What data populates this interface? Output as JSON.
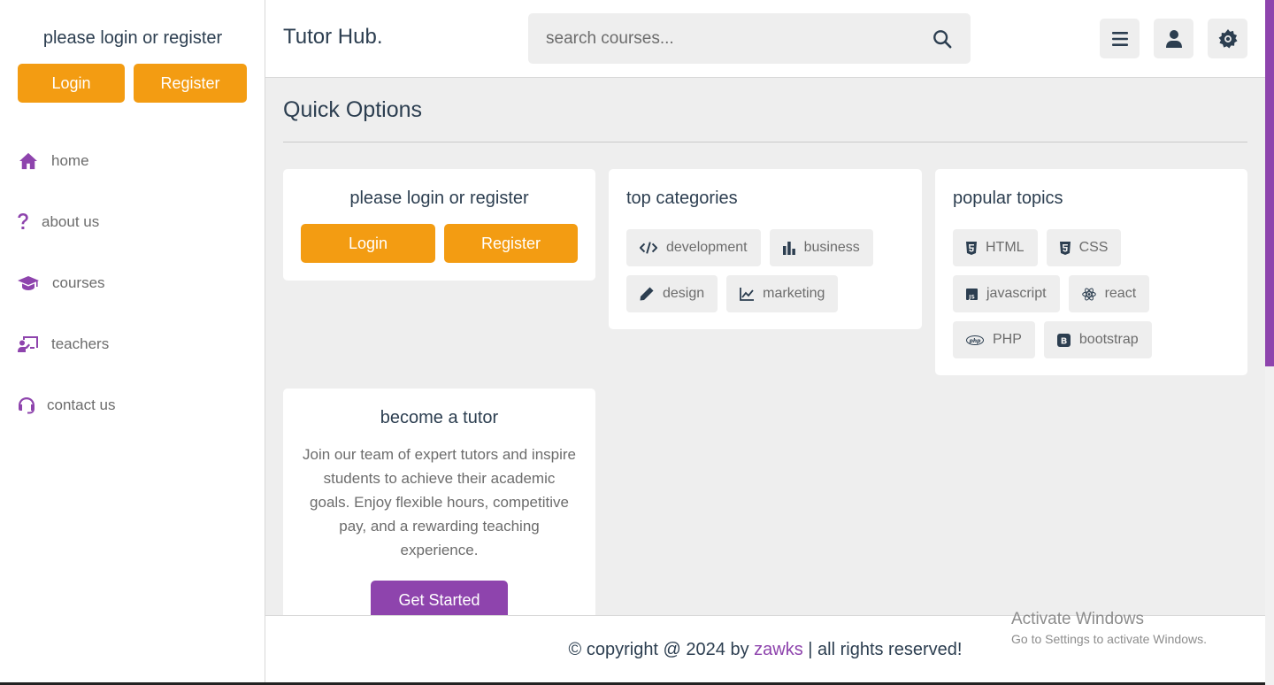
{
  "sidebar": {
    "title": "please login or register",
    "login_label": "Login",
    "register_label": "Register",
    "nav": [
      {
        "label": "home",
        "icon": "home-icon"
      },
      {
        "label": "about us",
        "icon": "question-icon"
      },
      {
        "label": "courses",
        "icon": "graduation-cap-icon"
      },
      {
        "label": "teachers",
        "icon": "chalkboard-teacher-icon"
      },
      {
        "label": "contact us",
        "icon": "headset-icon"
      }
    ]
  },
  "header": {
    "logo": "Tutor Hub.",
    "search_placeholder": "search courses...",
    "icons": [
      "menu-icon",
      "user-icon",
      "settings-icon"
    ]
  },
  "main": {
    "heading": "Quick Options",
    "login_card": {
      "title": "please login or register",
      "login_label": "Login",
      "register_label": "Register"
    },
    "categories": {
      "title": "top categories",
      "items": [
        {
          "label": "development",
          "icon": "code-icon"
        },
        {
          "label": "business",
          "icon": "bar-chart-icon"
        },
        {
          "label": "design",
          "icon": "pen-icon"
        },
        {
          "label": "marketing",
          "icon": "line-chart-icon"
        }
      ]
    },
    "topics": {
      "title": "popular topics",
      "items": [
        {
          "label": "HTML",
          "icon": "html5-icon"
        },
        {
          "label": "CSS",
          "icon": "css3-icon"
        },
        {
          "label": "javascript",
          "icon": "js-icon"
        },
        {
          "label": "react",
          "icon": "react-icon"
        },
        {
          "label": "PHP",
          "icon": "php-icon"
        },
        {
          "label": "bootstrap",
          "icon": "bootstrap-icon"
        }
      ]
    },
    "tutor": {
      "title": "become a tutor",
      "text": "Join our team of expert tutors and inspire students to achieve their academic goals. Enjoy flexible hours, competitive pay, and a rewarding teaching experience.",
      "button": "Get Started"
    }
  },
  "footer": {
    "prefix": "© copyright @ 2024 by ",
    "brand": "zawks",
    "suffix": " | all rights reserved!"
  },
  "watermark": {
    "line1": "Activate Windows",
    "line2": "Go to Settings to activate Windows."
  },
  "colors": {
    "accent": "#8e44ad",
    "orange": "#f39c12",
    "text": "#2c3e50",
    "background": "#eeeeee"
  }
}
